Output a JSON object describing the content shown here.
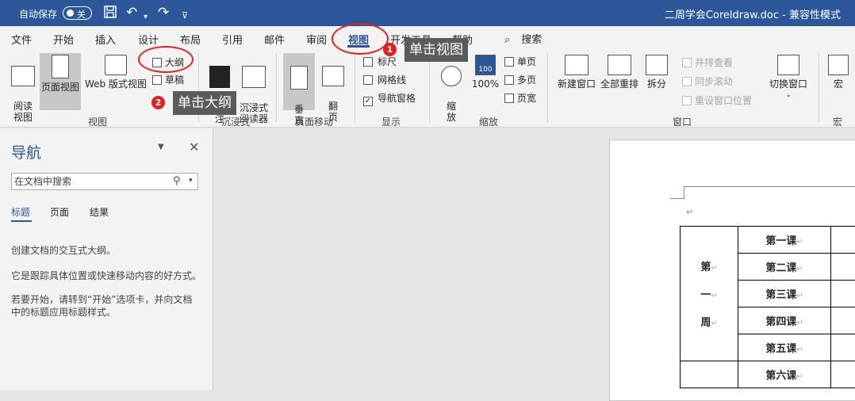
{
  "titlebar": {
    "autosave_label": "自动保存",
    "autosave_state": "关",
    "save_icon": "save-icon",
    "undo_icon": "undo-icon",
    "redo_icon": "redo-icon",
    "customize_icon": "customize-qat-icon",
    "document_title": "二周学会Coreldraw.doc  -  兼容性模式"
  },
  "tabs": {
    "file": "文件",
    "home": "开始",
    "insert": "插入",
    "design": "设计",
    "layout": "布局",
    "references": "引用",
    "mailings": "邮件",
    "review": "审阅",
    "view": "视图",
    "developer": "开发工具",
    "help": "帮助",
    "search": "搜索"
  },
  "ribbon": {
    "views": {
      "read_mode": "阅读\n视图",
      "print_layout": "页面视图",
      "web_layout": "Web 版式视图",
      "outline": "大纲",
      "draft": "草稿",
      "group": "视图"
    },
    "immersive": {
      "focus": "专\n注",
      "immersive_reader": "沉浸式\n阅读器",
      "group": "沉浸式"
    },
    "page_movement": {
      "vertical": "垂\n直",
      "side_to_side": "翻\n页",
      "group": "页面移动"
    },
    "show": {
      "ruler": "标尺",
      "gridlines": "网格线",
      "nav_pane": "导航窗格",
      "group": "显示"
    },
    "zoom": {
      "zoom": "缩\n放",
      "hundred": "100%",
      "hundred_icon_text": "100",
      "one_page": "单页",
      "multiple_pages": "多页",
      "page_width": "页宽",
      "group": "缩放"
    },
    "window": {
      "new_window": "新建窗口",
      "arrange_all": "全部重排",
      "split": "拆分",
      "side_by_side": "并排查看",
      "sync_scroll": "同步滚动",
      "reset_position": "重设窗口位置",
      "switch_windows": "切换窗口",
      "group": "窗口"
    },
    "macros": {
      "macros": "宏",
      "group": "宏"
    }
  },
  "annotations": {
    "step1_number": "1",
    "step1_text": "单击视图",
    "step2_number": "2",
    "step2_text": "单击大纲"
  },
  "nav_pane": {
    "title": "导航",
    "search_placeholder": "在文档中搜索",
    "tabs": [
      "标题",
      "页面",
      "结果"
    ],
    "line1": "创建文档的交互式大纲。",
    "line2": "它是跟踪具体位置或快速移动内容的好方式。",
    "line3": "若要开始，请转到“开始”选项卡，并向文档中的标题应用标题样式。"
  },
  "document": {
    "week_chars": [
      "第",
      "一",
      "周"
    ],
    "lessons": [
      "第一课",
      "第二课",
      "第三课",
      "第四课",
      "第五课",
      "第六课"
    ],
    "para_mark": "↵"
  }
}
